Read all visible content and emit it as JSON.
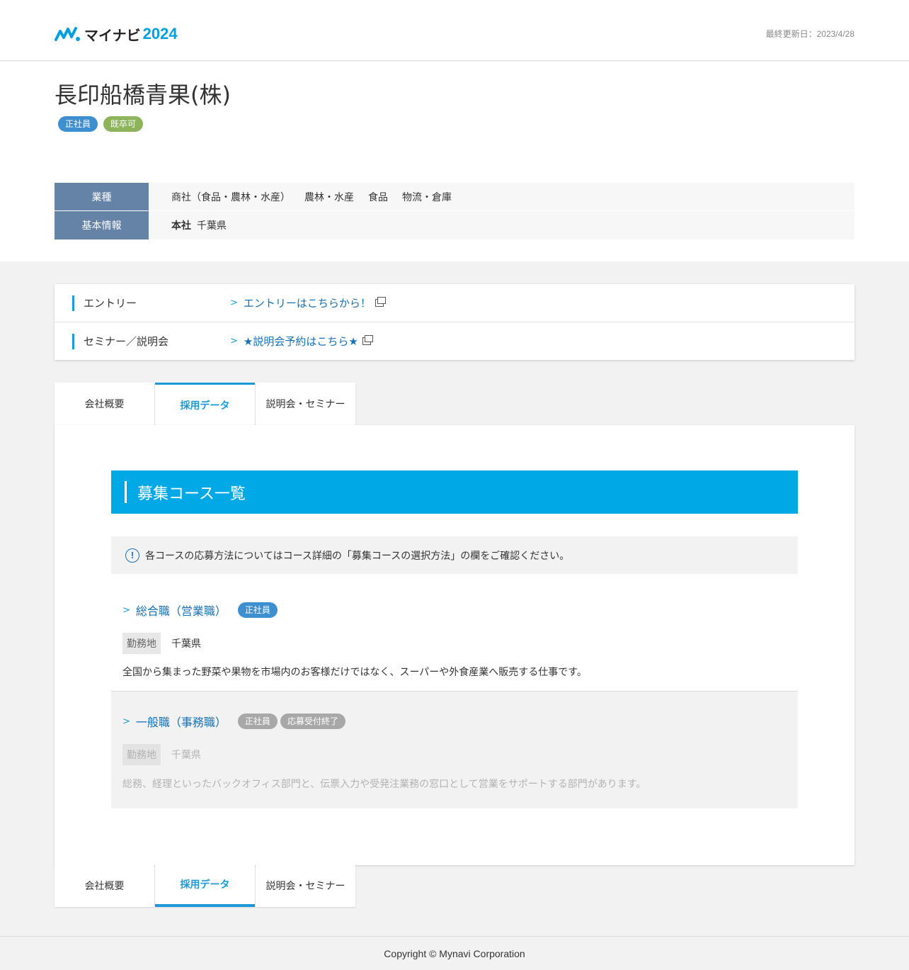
{
  "header": {
    "logo_text": "マイナビ",
    "logo_year": "2024",
    "updated": "最終更新日：2023/4/28"
  },
  "company": {
    "name": "長印船橋青果(株)",
    "tags": [
      "正社員",
      "既卒可"
    ]
  },
  "info": {
    "industry_label": "業種",
    "industry_items": [
      "商社（食品・農林・水産）",
      "農林・水産",
      "食品",
      "物流・倉庫"
    ],
    "basic_label": "基本情報",
    "hq_label": "本社",
    "hq_value": "千葉県"
  },
  "links": {
    "entry_label": "エントリー",
    "entry_link": "エントリーはこちらから！",
    "seminar_label": "セミナー／説明会",
    "seminar_link": "★説明会予約はこちら★"
  },
  "tabs": [
    "会社概要",
    "採用データ",
    "説明会・セミナー"
  ],
  "active_tab": "採用データ",
  "section": {
    "title": "募集コース一覧",
    "notice": "各コースの応募方法についてはコース詳細の「募集コースの選択方法」の欄をご確認ください。"
  },
  "courses": [
    {
      "title": "総合職（営業職）",
      "tags": [
        "正社員"
      ],
      "location_label": "勤務地",
      "location": "千葉県",
      "description": "全国から集まった野菜や果物を市場内のお客様だけではなく、スーパーや外食産業へ販売する仕事です。"
    },
    {
      "title": "一般職（事務職）",
      "tags": [
        "正社員",
        "応募受付終了"
      ],
      "location_label": "勤務地",
      "location": "千葉県",
      "description": "総務、経理といったバックオフィス部門と、伝票入力や受発注業務の窓口として営業をサポートする部門があります。"
    }
  ],
  "footer": "Copyright © Mynavi Corporation",
  "colors": {
    "accent": "#00a8e6",
    "link": "#1670b5",
    "info_head": "#6483a6",
    "tag_blue": "#3d8fcf",
    "tag_green": "#8db35b"
  }
}
